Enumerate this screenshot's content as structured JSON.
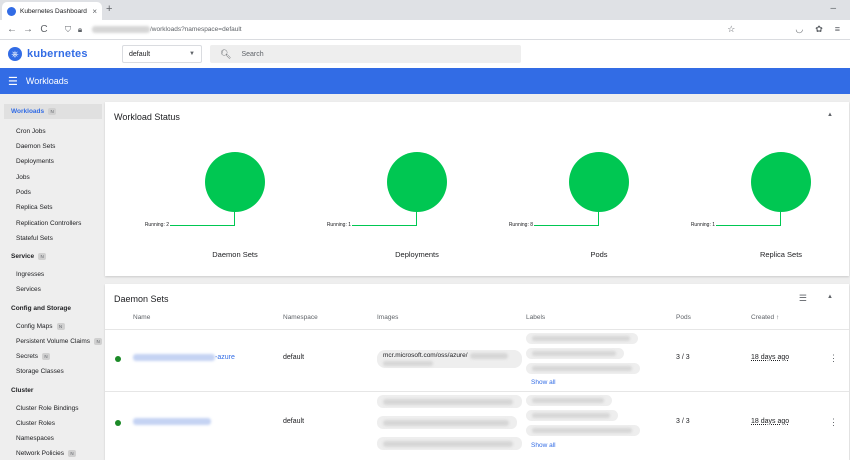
{
  "browser": {
    "tab_title": "Kubernetes Dashboard",
    "tab_close": "×",
    "new_tab": "+",
    "window_minimize": "–",
    "back": "←",
    "forward": "→",
    "reload": "C",
    "url_path": "/workloads?namespace=default"
  },
  "header": {
    "brand": "kubernetes",
    "namespace": "default",
    "search_placeholder": "Search",
    "page_title": "Workloads"
  },
  "sidebar": {
    "items": [
      {
        "label": "Workloads",
        "badge": "N"
      },
      {
        "label": "Cron Jobs"
      },
      {
        "label": "Daemon Sets"
      },
      {
        "label": "Deployments"
      },
      {
        "label": "Jobs"
      },
      {
        "label": "Pods"
      },
      {
        "label": "Replica Sets"
      },
      {
        "label": "Replication Controllers"
      },
      {
        "label": "Stateful Sets"
      },
      {
        "label": "Service",
        "badge": "N"
      },
      {
        "label": "Ingresses"
      },
      {
        "label": "Services"
      },
      {
        "label": "Config and Storage"
      },
      {
        "label": "Config Maps",
        "badge": "N"
      },
      {
        "label": "Persistent Volume Claims",
        "badge": "N"
      },
      {
        "label": "Secrets",
        "badge": "N"
      },
      {
        "label": "Storage Classes"
      },
      {
        "label": "Cluster"
      },
      {
        "label": "Cluster Role Bindings"
      },
      {
        "label": "Cluster Roles"
      },
      {
        "label": "Namespaces"
      },
      {
        "label": "Network Policies",
        "badge": "N"
      }
    ]
  },
  "workload_status": {
    "title": "Workload Status",
    "items": [
      {
        "label": "Daemon Sets",
        "legend": "Running: 2"
      },
      {
        "label": "Deployments",
        "legend": "Running: 1"
      },
      {
        "label": "Pods",
        "legend": "Running: 8"
      },
      {
        "label": "Replica Sets",
        "legend": "Running: 1"
      }
    ]
  },
  "daemon_sets": {
    "title": "Daemon Sets",
    "columns": [
      "Name",
      "Namespace",
      "Images",
      "Labels",
      "Pods",
      "Created"
    ],
    "sort_arrow": "↑",
    "rows": [
      {
        "name_suffix": "-azure",
        "namespace": "default",
        "image": "mcr.microsoft.com/oss/azure/",
        "pods": "3 / 3",
        "created": "18 days ago",
        "show_all": "Show all"
      },
      {
        "name_suffix": "",
        "namespace": "default",
        "image": "",
        "pods": "3 / 3",
        "created": "18 days ago",
        "show_all": "Show all"
      }
    ]
  },
  "colors": {
    "brand": "#326ce5",
    "running": "#00c752",
    "status_dot": "#1b8a27"
  }
}
